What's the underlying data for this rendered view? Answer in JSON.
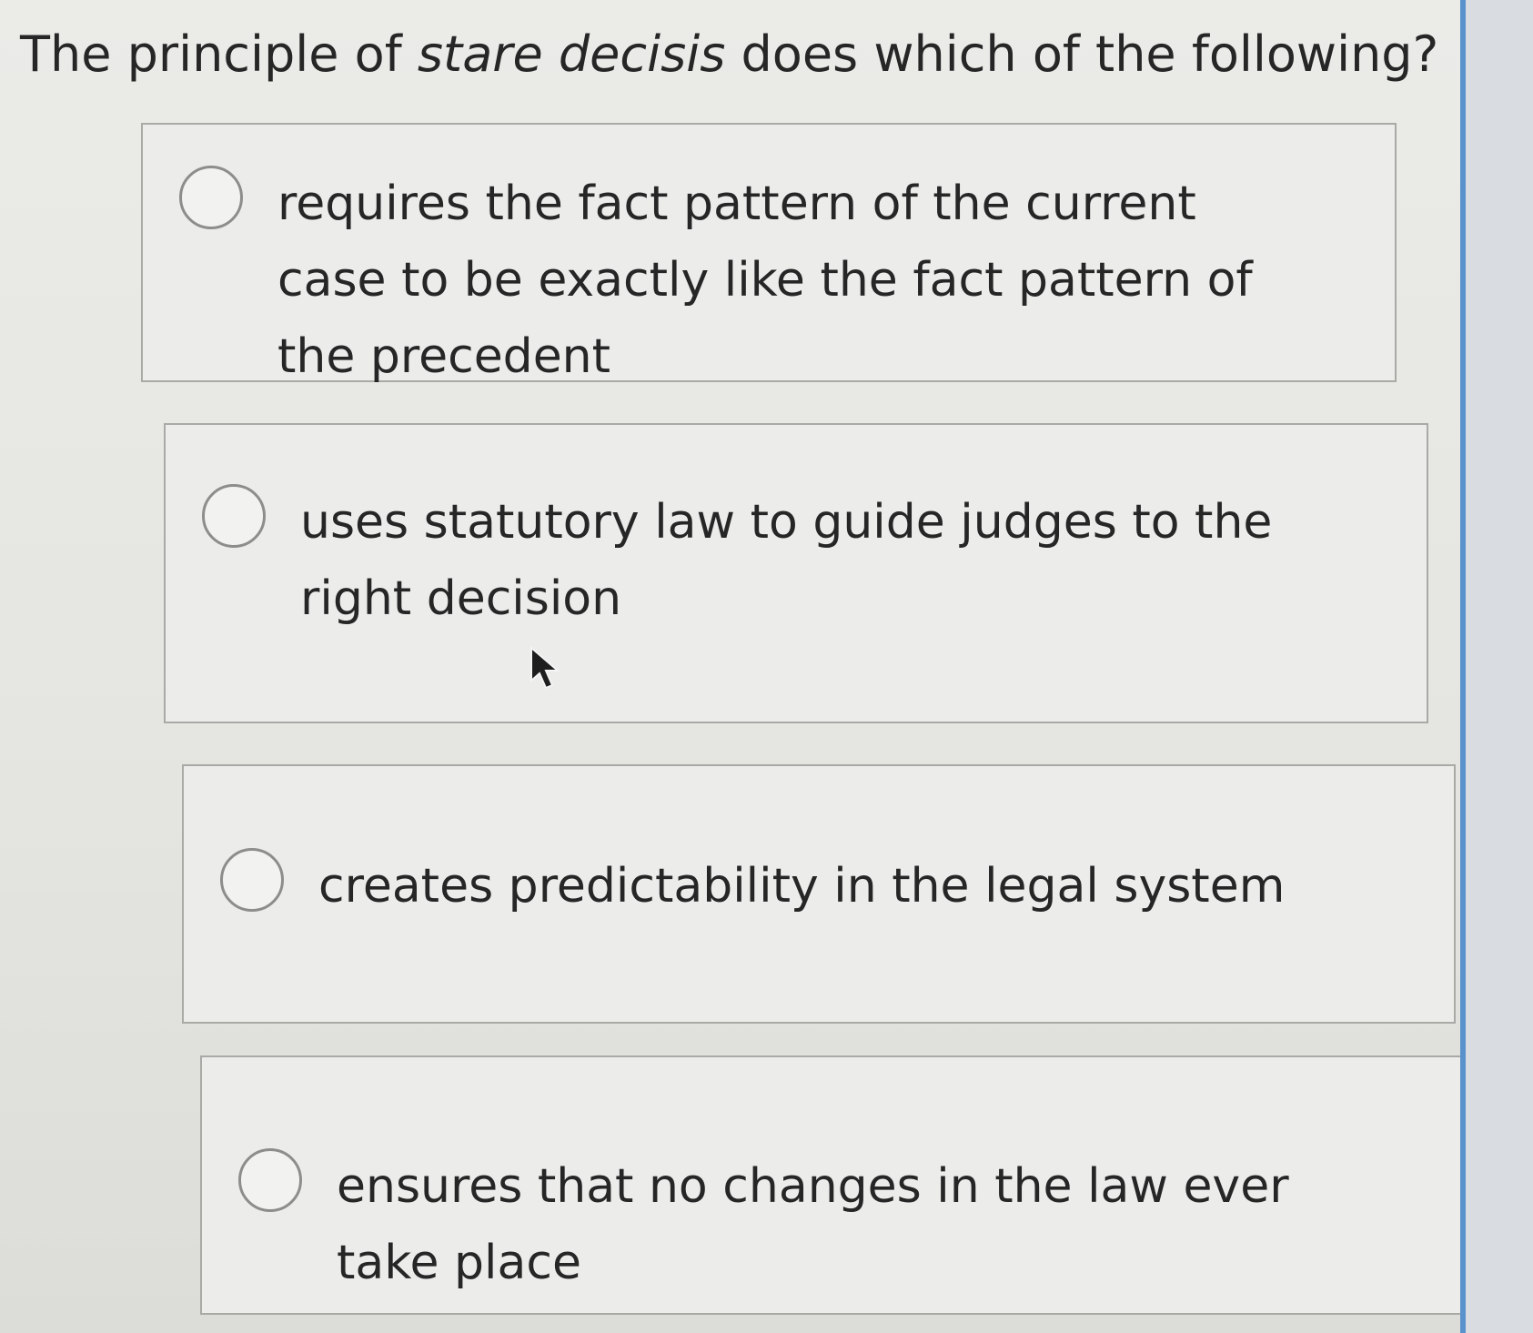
{
  "question": {
    "prefix": "The principle of ",
    "emphasis": "stare decisis",
    "suffix": " does which of the following?"
  },
  "options": [
    {
      "label": "requires the fact pattern of the current case to be exactly like the fact pattern of the precedent",
      "selected": false
    },
    {
      "label": "uses statutory law to guide judges to the right decision",
      "selected": false
    },
    {
      "label": "creates predictability in the legal system",
      "selected": false
    },
    {
      "label": "ensures that no changes in the law ever take place",
      "selected": false
    }
  ],
  "colors": {
    "accent_strip": "#5a92cc"
  },
  "icons": {
    "pointer": "mouse-pointer-icon",
    "radio": "radio-unselected-icon"
  }
}
